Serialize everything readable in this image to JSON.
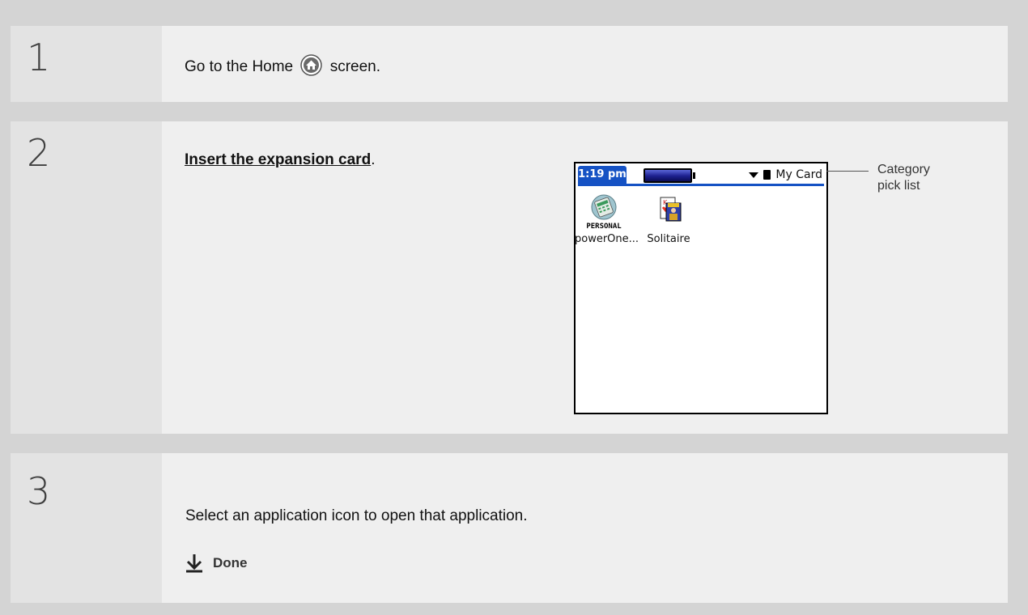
{
  "steps": [
    {
      "number": "1",
      "text_before": "Go to the Home",
      "text_after": "screen."
    },
    {
      "number": "2",
      "link": "Insert the expansion card",
      "link_suffix": "."
    },
    {
      "number": "3",
      "text": "Select an application icon to open that application.",
      "done": "Done"
    }
  ],
  "device_screen": {
    "time": "1:19 pm",
    "category": "My Card",
    "apps": [
      {
        "icon_badge": "PERSONAL",
        "label": "powerOne..."
      },
      {
        "label": "Solitaire"
      }
    ]
  },
  "callout": {
    "line1": "Category",
    "line2": "pick list"
  },
  "icons": {
    "home": "home-icon",
    "done": "down-arrow-icon"
  },
  "colors": {
    "accent": "#1552c4"
  }
}
